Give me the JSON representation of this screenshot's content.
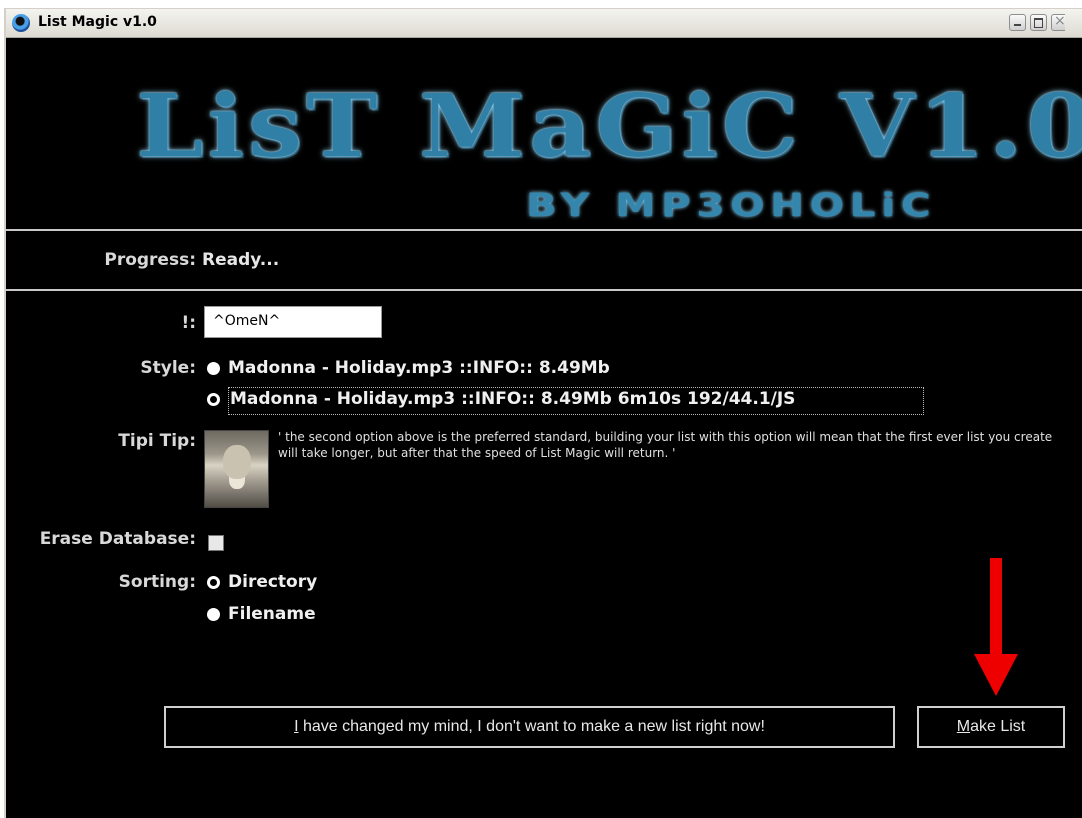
{
  "window": {
    "title": "List Magic v1.0"
  },
  "banner": {
    "logo_main": "LisT MaGiC V1.0",
    "logo_sub": "BY MP3OHOLiC"
  },
  "progress": {
    "label": "Progress:",
    "value": "Ready..."
  },
  "name_field": {
    "label": "!:",
    "value": "^OmeN^"
  },
  "style": {
    "label": "Style:",
    "options": [
      {
        "label": "Madonna - Holiday.mp3  ::INFO:: 8.49Mb",
        "selected": false
      },
      {
        "label": "Madonna - Holiday.mp3  ::INFO:: 8.49Mb 6m10s 192/44.1/JS",
        "selected": true
      }
    ]
  },
  "tip": {
    "label": "Tipi Tip:",
    "text": "' the second option above is the preferred standard, building your list with this option will mean that the first ever list you create will take longer, but after that the speed of List Magic will return. '"
  },
  "erase_db": {
    "label": "Erase Database:",
    "checked": false
  },
  "sorting": {
    "label": "Sorting:",
    "options": [
      {
        "label": "Directory",
        "selected": true
      },
      {
        "label": "Filename",
        "selected": false
      }
    ]
  },
  "buttons": {
    "cancel_mnemonic": "I",
    "cancel_rest": " have changed my mind, I don't want to make a new list right now!",
    "make_mnemonic": "M",
    "make_rest": "ake List"
  },
  "colors": {
    "background": "#000000",
    "arrow": "#ee0000",
    "logo": "#2f7fa6"
  }
}
